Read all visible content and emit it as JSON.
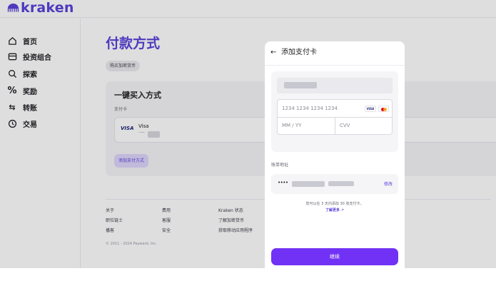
{
  "brand": {
    "name": "kraken",
    "accent": "#5741d9",
    "button": "#7132f5"
  },
  "sidebar": {
    "items": [
      {
        "label": "首页",
        "icon": "home-icon"
      },
      {
        "label": "投资组合",
        "icon": "wallet-icon"
      },
      {
        "label": "探索",
        "icon": "search-icon"
      },
      {
        "label": "奖励",
        "icon": "percent-icon"
      },
      {
        "label": "转账",
        "icon": "transfer-icon"
      },
      {
        "label": "交易",
        "icon": "clock-icon"
      }
    ]
  },
  "main": {
    "title": "付款方式",
    "tag": "购买加密货币",
    "section_title": "一键买入方式",
    "payment_card_label": "支付卡",
    "visa": {
      "mark": "VISA",
      "name": "Visa",
      "digits": "····"
    },
    "add_method_label": "添加支付方式"
  },
  "footer": {
    "links": [
      [
        "关于",
        "费用",
        "Kraken 状态"
      ],
      [
        "职位链士",
        "客服",
        "了解加密货币"
      ],
      [
        "播客",
        "安全",
        "获取移动应用程序"
      ]
    ],
    "copyright": "© 2011 - 2024 Payward, Inc."
  },
  "modal": {
    "back_label": "←",
    "title": "添加支付卡",
    "card_number_placeholder": "1234 1234 1234 1234",
    "brand_visa": "VISA",
    "expiry_placeholder": "MM / YY",
    "cvv_placeholder": "CVV",
    "billing_label": "账单地址",
    "billing_dots": "••••",
    "edit_label": "修改",
    "note": "您可以在 3 天内添加 30 张支付卡。",
    "learn_more": "了解更多 ↗",
    "continue_label": "继续"
  }
}
